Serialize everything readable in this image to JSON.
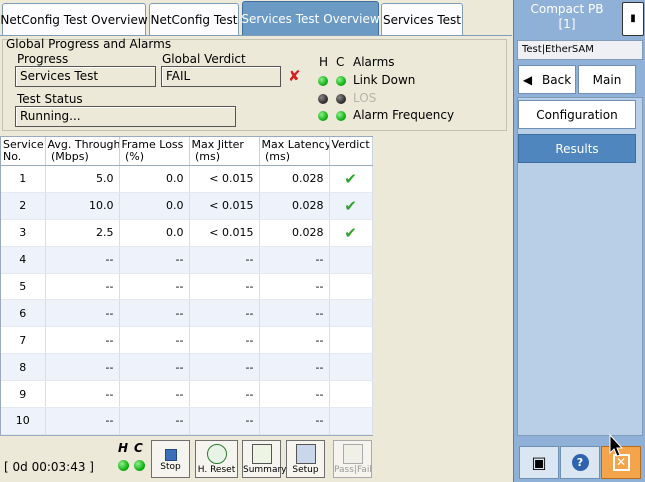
{
  "tabs": [
    {
      "label": "NetConfig Test Overview",
      "active": false
    },
    {
      "label": "NetConfig Test",
      "active": false
    },
    {
      "label": "Services Test Overview",
      "active": true
    },
    {
      "label": "Services Test",
      "active": false
    }
  ],
  "global": {
    "title": "Global Progress and Alarms",
    "progress_label": "Progress",
    "progress_value": "Services Test",
    "verdict_label": "Global Verdict",
    "verdict_value": "FAIL",
    "status_label": "Test Status",
    "status_value": "Running...",
    "h_label": "H",
    "c_label": "C",
    "alarms_label": "Alarms",
    "alarms": [
      {
        "label": "Link Down",
        "h": "green",
        "c": "green",
        "disabled": false
      },
      {
        "label": "LOS",
        "h": "gray",
        "c": "gray",
        "disabled": true
      },
      {
        "label": "Alarm Frequency",
        "h": "green",
        "c": "green",
        "disabled": false
      }
    ]
  },
  "table": {
    "headers": [
      [
        "Service",
        "No."
      ],
      [
        "Avg. Through.",
        "(Mbps)"
      ],
      [
        "Frame Loss",
        "(%)"
      ],
      [
        "Max Jitter",
        "(ms)"
      ],
      [
        "Max Latency",
        "(ms)"
      ],
      [
        "Verdict",
        ""
      ]
    ],
    "rows": [
      {
        "service": "1",
        "throughput": "5.0",
        "loss": "0.0",
        "jitter": "< 0.015",
        "latency": "0.028",
        "verdict": "pass"
      },
      {
        "service": "2",
        "throughput": "10.0",
        "loss": "0.0",
        "jitter": "< 0.015",
        "latency": "0.028",
        "verdict": "pass"
      },
      {
        "service": "3",
        "throughput": "2.5",
        "loss": "0.0",
        "jitter": "< 0.015",
        "latency": "0.028",
        "verdict": "pass"
      },
      {
        "service": "4",
        "throughput": "--",
        "loss": "--",
        "jitter": "--",
        "latency": "--",
        "verdict": ""
      },
      {
        "service": "5",
        "throughput": "--",
        "loss": "--",
        "jitter": "--",
        "latency": "--",
        "verdict": ""
      },
      {
        "service": "6",
        "throughput": "--",
        "loss": "--",
        "jitter": "--",
        "latency": "--",
        "verdict": ""
      },
      {
        "service": "7",
        "throughput": "--",
        "loss": "--",
        "jitter": "--",
        "latency": "--",
        "verdict": ""
      },
      {
        "service": "8",
        "throughput": "--",
        "loss": "--",
        "jitter": "--",
        "latency": "--",
        "verdict": ""
      },
      {
        "service": "9",
        "throughput": "--",
        "loss": "--",
        "jitter": "--",
        "latency": "--",
        "verdict": ""
      },
      {
        "service": "10",
        "throughput": "--",
        "loss": "--",
        "jitter": "--",
        "latency": "--",
        "verdict": ""
      }
    ]
  },
  "bottom": {
    "timer": "[ 0d 00:03:43 ]",
    "h_label": "H",
    "c_label": "C",
    "buttons": [
      {
        "label": "Stop",
        "icon": "stop-icon",
        "disabled": false
      },
      {
        "label": "H. Reset",
        "icon": "history-reset-icon",
        "disabled": false
      },
      {
        "label": "Summary",
        "icon": "summary-icon",
        "disabled": false
      },
      {
        "label": "Setup",
        "icon": "setup-icon",
        "disabled": false
      },
      {
        "label": "Pass|Fail",
        "icon": "pass-fail-icon",
        "disabled": true
      }
    ]
  },
  "right": {
    "title_line1": "Compact PB",
    "title_line2": "[1]",
    "path": "Test|EtherSAM",
    "back_label": "Back",
    "main_label": "Main",
    "configuration_label": "Configuration",
    "results_label": "Results"
  },
  "colors": {
    "accent": "#4f86bd",
    "pass": "#2fa52f",
    "fail": "#d42020",
    "led_green": "#16b316"
  }
}
